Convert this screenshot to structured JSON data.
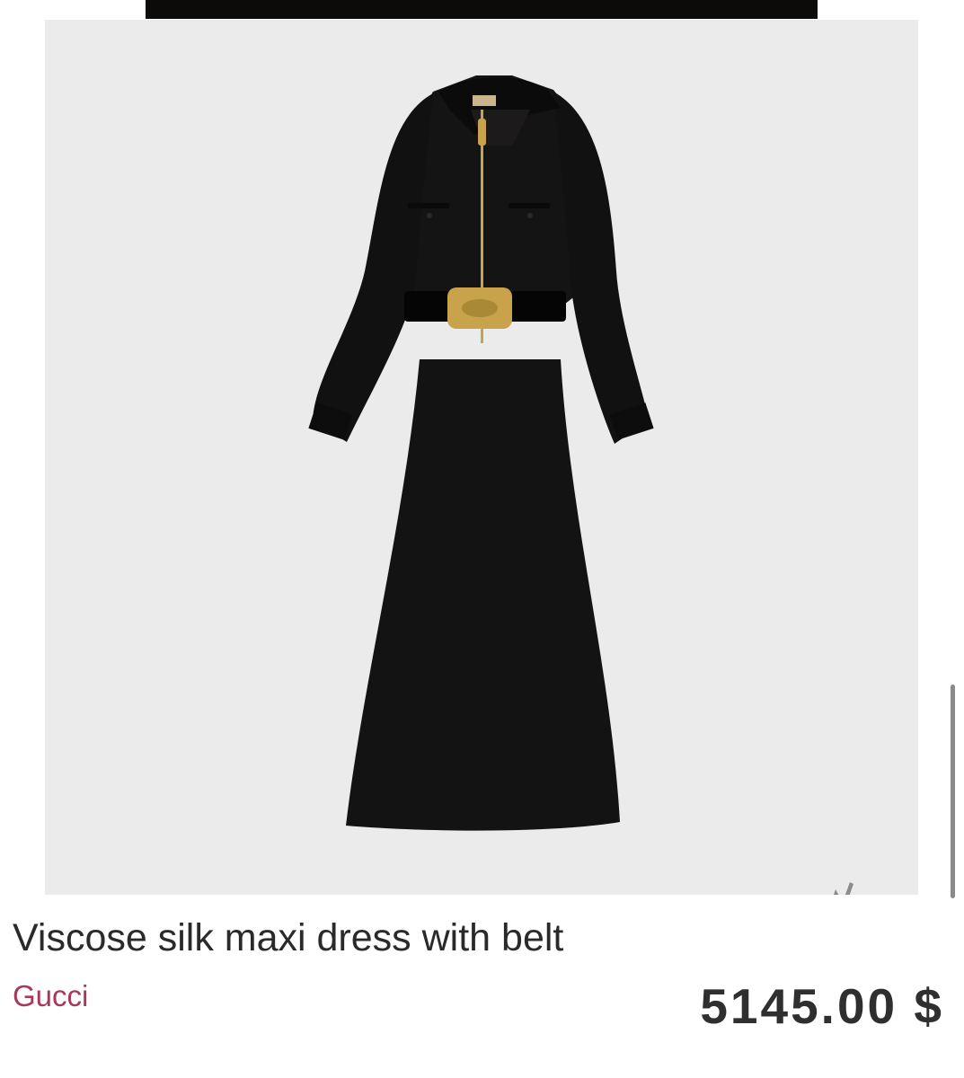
{
  "product": {
    "title": "Viscose silk maxi dress with belt",
    "brand": "Gucci",
    "price": "5145.00 $"
  },
  "image": {
    "background_color": "#ebebeb",
    "dress_color": "#141313",
    "hardware_color": "#c9a24c",
    "watermark_icon": "lightning-n-icon"
  },
  "colors": {
    "brand": "#a8385a",
    "title": "#2a2a2a",
    "price": "#2f2f2f"
  }
}
